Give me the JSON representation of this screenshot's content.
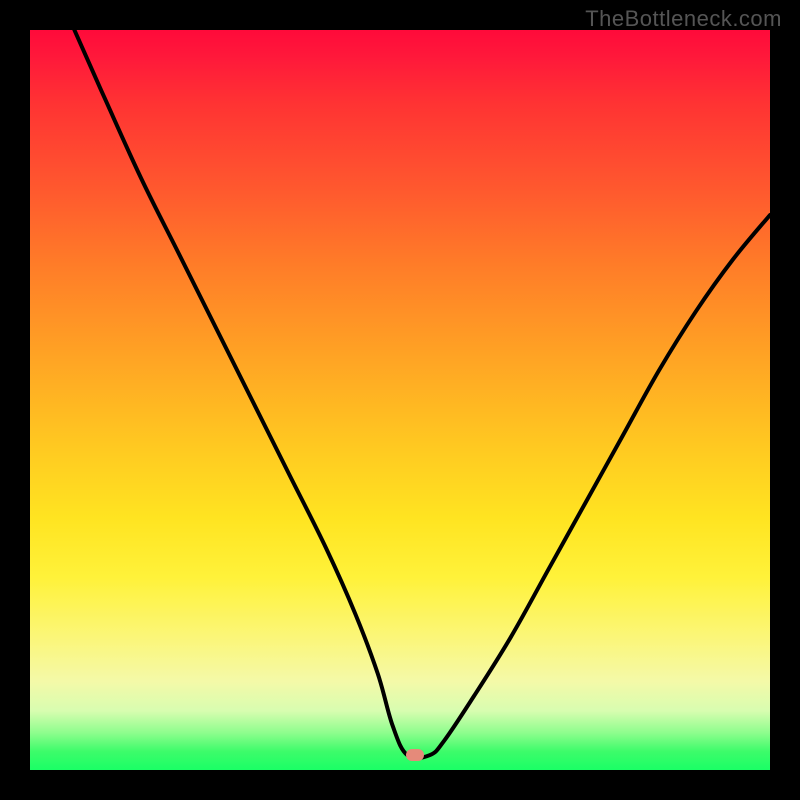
{
  "watermark": "TheBottleneck.com",
  "colors": {
    "background": "#000000",
    "curve": "#000000",
    "marker": "#e58a7a",
    "gradient_top": "#ff0a3a",
    "gradient_bottom": "#1aff66"
  },
  "chart_data": {
    "type": "line",
    "title": "",
    "xlabel": "",
    "ylabel": "",
    "xlim": [
      0,
      100
    ],
    "ylim": [
      0,
      100
    ],
    "grid": false,
    "legend": false,
    "annotations": [
      "TheBottleneck.com"
    ],
    "background": "vertical heat gradient red→yellow→green (low is good)",
    "marker": {
      "x": 52,
      "y": 2,
      "shape": "rounded"
    },
    "series": [
      {
        "name": "bottleneck-curve",
        "x": [
          6,
          10,
          15,
          20,
          25,
          30,
          35,
          40,
          44,
          47,
          49,
          51,
          54,
          56,
          60,
          65,
          70,
          75,
          80,
          85,
          90,
          95,
          100
        ],
        "y": [
          100,
          91,
          80,
          70,
          60,
          50,
          40,
          30,
          21,
          13,
          6,
          2,
          2,
          4,
          10,
          18,
          27,
          36,
          45,
          54,
          62,
          69,
          75
        ]
      }
    ]
  }
}
